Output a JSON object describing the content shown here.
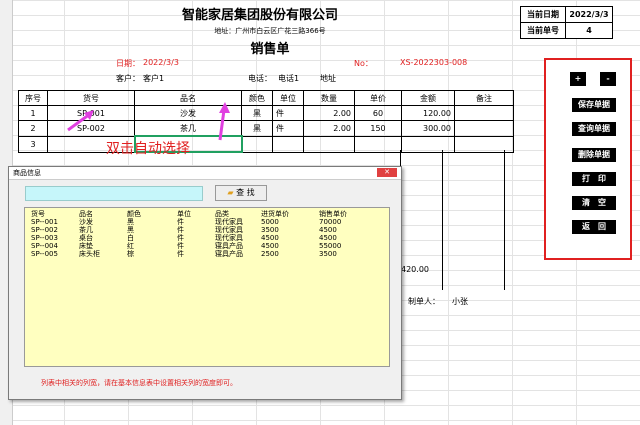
{
  "header": {
    "company": "智能家居集团股份有限公司",
    "address": "地址：广州市白云区广花三路366号",
    "doc_title": "销售单",
    "date_label": "日期：",
    "date_value": "2022/3/3",
    "no_label": "No：",
    "no_value": "XS-2022303-008",
    "customer_label": "客户：",
    "customer_value": "客户1",
    "phone_label": "电话：",
    "phone_value": "电话1",
    "addr_label": "地址"
  },
  "top_right": {
    "current_date_label": "当前日期",
    "current_date_value": "2022/3/3",
    "current_no_label": "当前单号",
    "current_no_value": "4"
  },
  "table": {
    "columns": [
      "序号",
      "货号",
      "品名",
      "颜色",
      "单位",
      "数量",
      "单价",
      "金额",
      "备注"
    ],
    "rows": [
      [
        "1",
        "SP-001",
        "沙发",
        "黑",
        "件",
        "2.00",
        "60",
        "120.00",
        ""
      ],
      [
        "2",
        "SP-002",
        "茶几",
        "黑",
        "件",
        "2.00",
        "150",
        "300.00",
        ""
      ],
      [
        "3",
        "",
        "",
        "",
        "",
        "",
        "",
        "",
        ""
      ]
    ]
  },
  "partial_total": "420.00",
  "maker_label": "制单人：",
  "maker_value": "小张",
  "panel": {
    "plus": "+",
    "minus": "-",
    "save": "保存单据",
    "query": "查询单据",
    "delete": "删除单据",
    "print": "打　印",
    "clear": "清　空",
    "back": "返　回"
  },
  "annotation": "双击自动选择",
  "dialog": {
    "title": "商品信息",
    "close": "✕",
    "search_label": "查 找",
    "list_headers": [
      "货号",
      "品名",
      "颜色",
      "单位",
      "品类",
      "进货单价",
      "销售单价"
    ],
    "items": [
      [
        "SP--001",
        "沙发",
        "黑",
        "件",
        "现代家具",
        "5000",
        "70000"
      ],
      [
        "SP--002",
        "茶几",
        "黑",
        "件",
        "现代家具",
        "3500",
        "4500"
      ],
      [
        "SP--003",
        "桌台",
        "白",
        "件",
        "现代家具",
        "4500",
        "4500"
      ],
      [
        "SP--004",
        "床垫",
        "红",
        "件",
        "寝具产品",
        "4500",
        "55000"
      ],
      [
        "SP--005",
        "床头柜",
        "棕",
        "件",
        "寝具产品",
        "2500",
        "3500"
      ]
    ],
    "note": "列表中相关的列宽，请在基本信息表中设置相关列的宽度即可。"
  },
  "colors": {
    "accent_red": "#e02020",
    "annot_magenta": "#e040e0",
    "search_bg": "#c6f6fa",
    "list_bg": "#ffffc0"
  }
}
